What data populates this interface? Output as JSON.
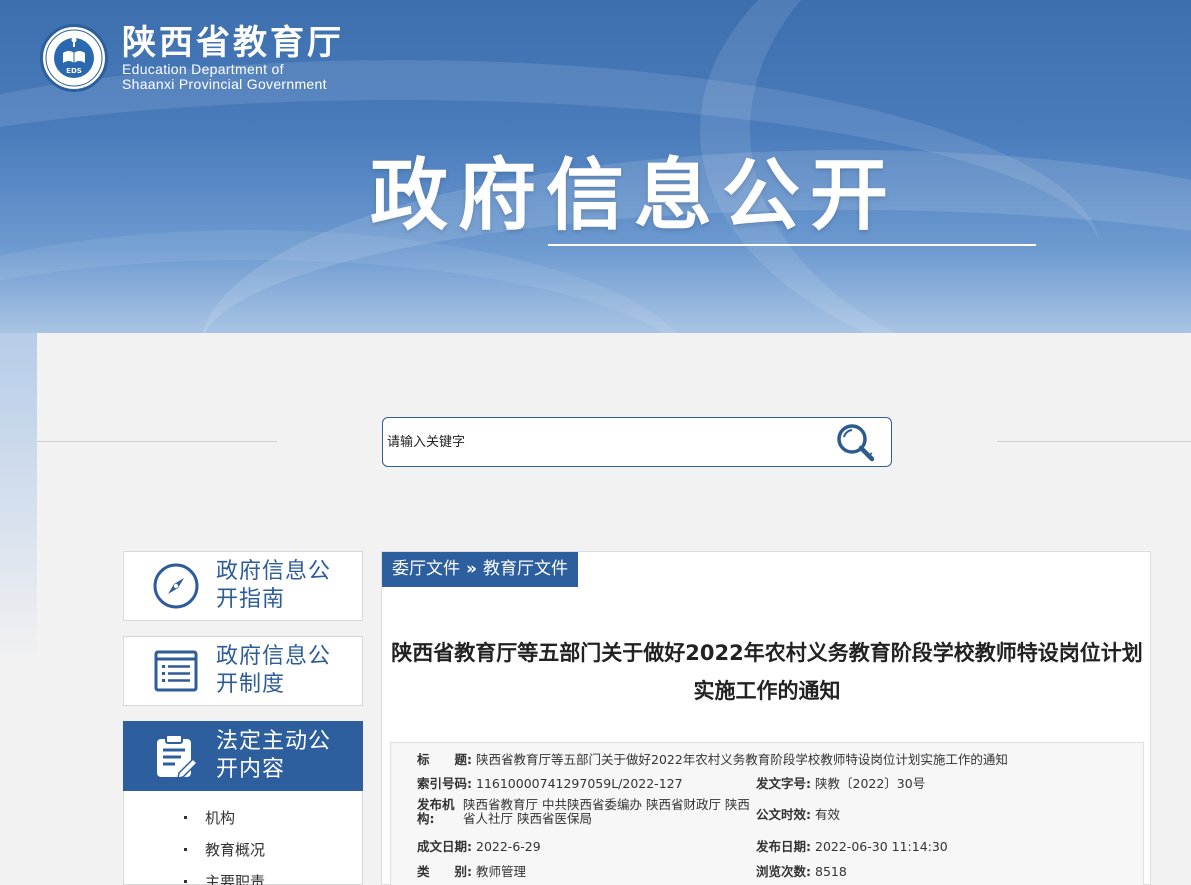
{
  "header": {
    "org_cn": "陕西省教育厅",
    "org_en_line1": "Education Department of",
    "org_en_line2": "Shaanxi Provincial Government",
    "logo_text": "EDS",
    "hero_title": "政府信息公开"
  },
  "search": {
    "placeholder": "请输入关键字",
    "icon": "search-icon"
  },
  "sidebar": {
    "cards": [
      {
        "label": "政府信息公开指南",
        "icon": "compass-icon",
        "active": false
      },
      {
        "label": "政府信息公开制度",
        "icon": "document-list-icon",
        "active": false
      },
      {
        "label": "法定主动公开内容",
        "icon": "clipboard-edit-icon",
        "active": true
      }
    ],
    "sub_items": [
      "机构",
      "教育概况",
      "主要职责"
    ]
  },
  "breadcrumb": {
    "level1": "委厅文件",
    "separator": "»",
    "level2": "教育厅文件"
  },
  "article": {
    "title": "陕西省教育厅等五部门关于做好2022年农村义务教育阶段学校教师特设岗位计划实施工作的通知",
    "meta": {
      "title_label": "标　　题:",
      "title_value": "陕西省教育厅等五部门关于做好2022年农村义务教育阶段学校教师特设岗位计划实施工作的通知",
      "index_label": "索引号码:",
      "index_value": "11610000741297059L/2022-127",
      "doc_no_label": "发文字号:",
      "doc_no_value": "陕教〔2022〕30号",
      "issuer_label": "发布机构:",
      "issuer_value": "陕西省教育厅 中共陕西省委编办 陕西省财政厅 陕西省人社厅 陕西省医保局",
      "validity_label": "公文时效:",
      "validity_value": "有效",
      "created_label": "成文日期:",
      "created_value": "2022-6-29",
      "published_label": "发布日期:",
      "published_value": "2022-06-30 11:14:30",
      "category_label": "类　　别:",
      "category_value": "教师管理",
      "views_label": "浏览次数:",
      "views_value": "8518"
    }
  },
  "colors": {
    "brand_blue": "#2d5f9f",
    "banner_top": "#3d6fae",
    "page_bg": "#f2f2f2"
  }
}
